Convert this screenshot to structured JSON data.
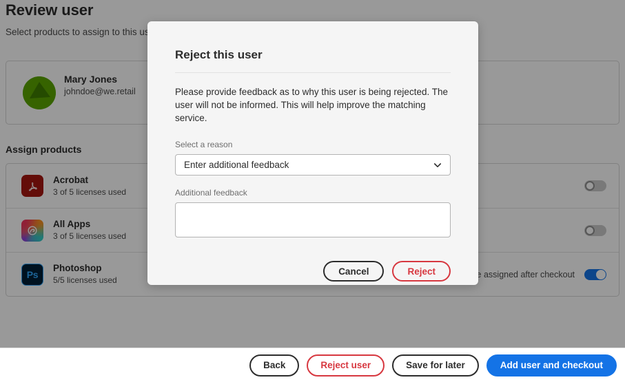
{
  "page": {
    "title": "Review user",
    "subtitle": "Select products to assign to this user",
    "section_title": "Assign products"
  },
  "user": {
    "name": "Mary Jones",
    "email": "johndoe@we.retail",
    "avatar_color": "#5aa500"
  },
  "products": [
    {
      "name": "Acrobat",
      "licenses": "3 of 5 licenses used",
      "icon": "acrobat-icon",
      "icon_label": "",
      "note": "",
      "toggle_on": false
    },
    {
      "name": "All Apps",
      "licenses": "3 of 5 licenses used",
      "icon": "all-apps-icon",
      "icon_label": "",
      "note": "",
      "toggle_on": false
    },
    {
      "name": "Photoshop",
      "licenses": "5/5 licenses used",
      "icon": "photoshop-icon",
      "icon_label": "Ps",
      "note": "Will be assigned after checkout",
      "toggle_on": true
    }
  ],
  "bottom_bar": {
    "back_label": "Back",
    "reject_user_label": "Reject user",
    "save_for_later_label": "Save for later",
    "add_user_checkout_label": "Add user and checkout"
  },
  "modal": {
    "title": "Reject this user",
    "body": "Please provide feedback as to why this user is being rejected. The user will not be informed. This will help improve the matching service.",
    "reason_label": "Select a reason",
    "reason_value": "Enter additional feedback",
    "feedback_label": "Additional feedback",
    "feedback_value": "",
    "feedback_placeholder": "",
    "cancel_label": "Cancel",
    "reject_label": "Reject"
  },
  "colors": {
    "accent_blue": "#1473e6",
    "danger_red": "#d7373f",
    "text_primary": "#2c2c2c",
    "text_secondary": "#6e6e6e"
  }
}
